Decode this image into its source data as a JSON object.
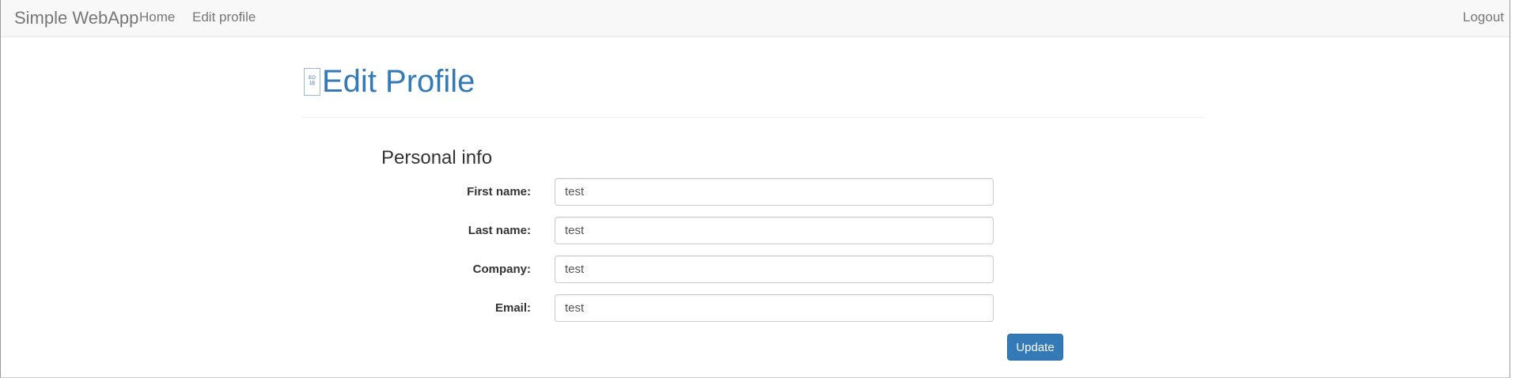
{
  "navbar": {
    "brand": "Simple WebApp",
    "links": [
      "Home",
      "Edit profile"
    ],
    "logout": "Logout"
  },
  "page": {
    "title": "Edit Profile",
    "icon": "broken-image-icon",
    "icon_glyph": [
      "EO",
      "1B"
    ]
  },
  "form": {
    "section_title": "Personal info",
    "fields": [
      {
        "label": "First name:",
        "value": "test"
      },
      {
        "label": "Last name:",
        "value": "test"
      },
      {
        "label": "Company:",
        "value": "test"
      },
      {
        "label": "Email:",
        "value": "test"
      }
    ],
    "submit_label": "Update"
  },
  "colors": {
    "accent": "#337ab7",
    "navbar_bg": "#f8f8f8",
    "nav_text": "#777777"
  }
}
